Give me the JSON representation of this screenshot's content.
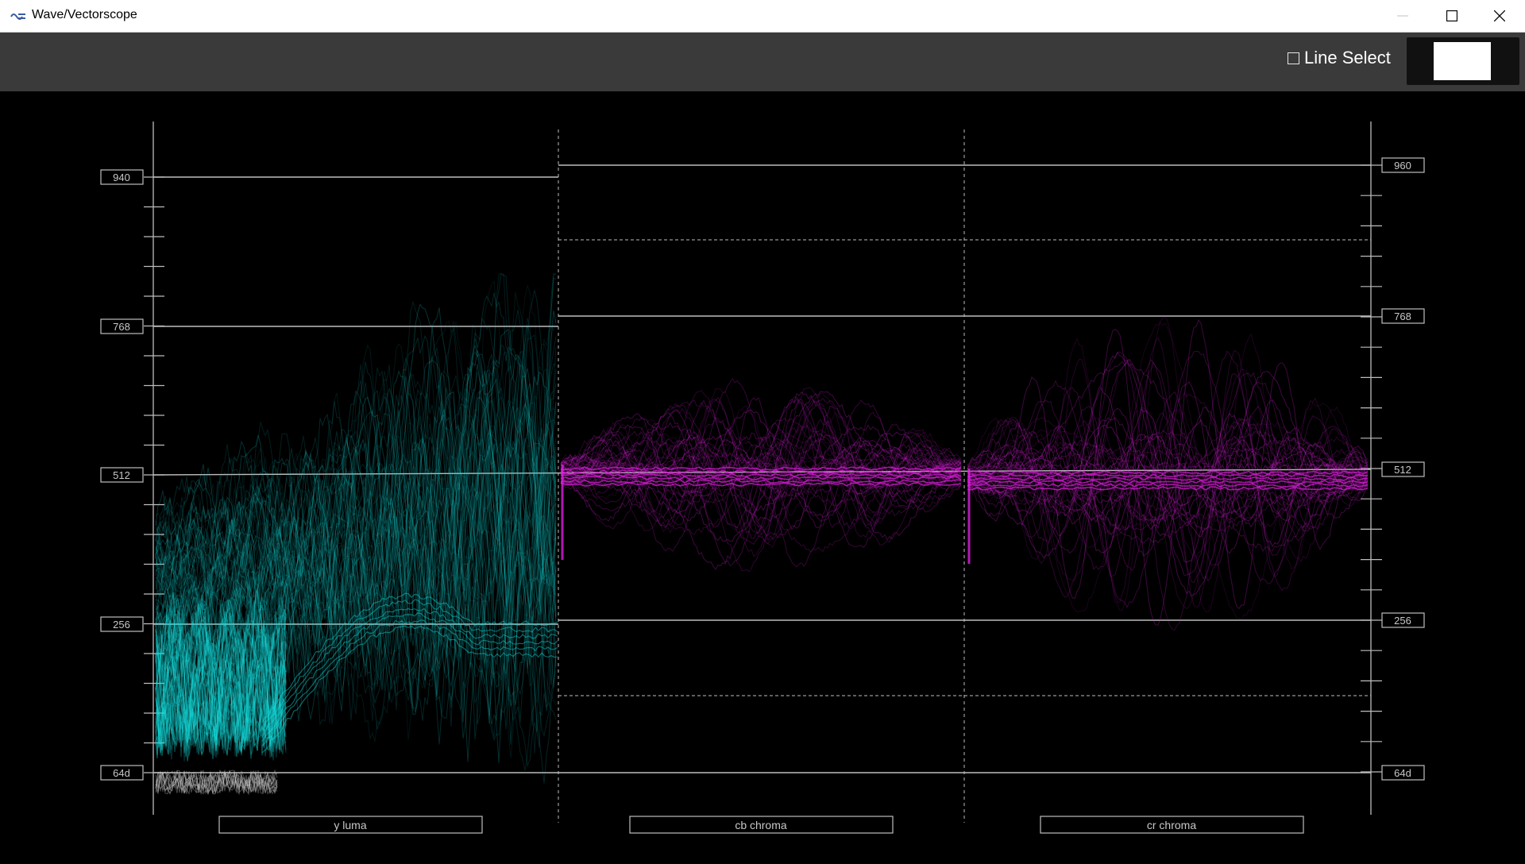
{
  "window": {
    "title": "Wave/Vectorscope",
    "icon": "app-logo-icon",
    "controls": [
      "minimize-icon",
      "maximize-icon",
      "close-icon"
    ]
  },
  "toolbar": {
    "line_select_label": "Line Select",
    "line_select_checked": false,
    "color_swatch": "#ffffff"
  },
  "scope": {
    "left_scale": [
      "940",
      "768",
      "512",
      "256",
      "64d"
    ],
    "right_scale": [
      "960",
      "768",
      "512",
      "256",
      "64d"
    ],
    "channels": [
      "y luma",
      "cb chroma",
      "cr chroma"
    ],
    "colors": {
      "luma": "#17e0e0",
      "chroma": "#e020e0",
      "graticule": "#bdbdbd",
      "background": "#000000"
    }
  }
}
